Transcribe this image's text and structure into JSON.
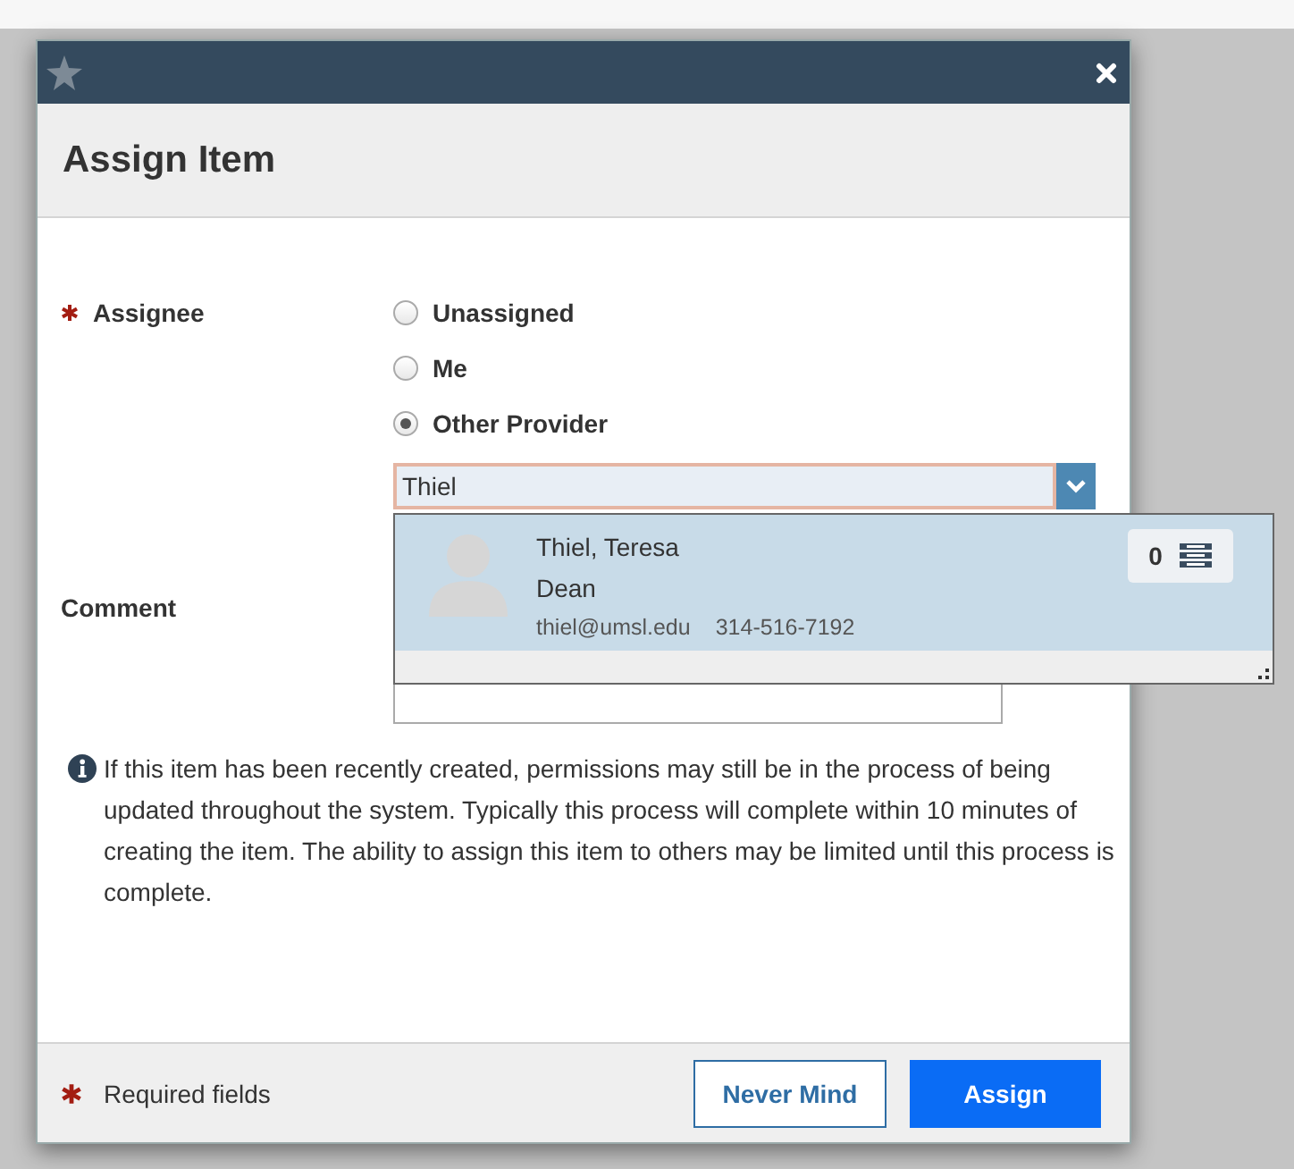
{
  "dialog": {
    "title": "Assign Item",
    "fields": [
      {
        "kind": "radio-group",
        "label": "Assignee",
        "required": true,
        "options": [
          {
            "label": "Unassigned",
            "selected": false
          },
          {
            "label": "Me",
            "selected": false
          },
          {
            "label": "Other Provider",
            "selected": true
          }
        ],
        "search": {
          "value": "Thiel"
        },
        "suggestions": [
          {
            "name": "Thiel, Teresa",
            "title": "Dean",
            "email": "thiel@umsl.edu",
            "phone": "314-516-7192",
            "count": "0",
            "selected": true
          }
        ]
      },
      {
        "kind": "textarea",
        "label": "Comment",
        "required": false
      }
    ],
    "info": "If this item has been recently created, permissions may still be in the process of being updated throughout the system. Typically this process will complete within 10 minutes of creating the item. The ability to assign this item to others may be limited until this process is complete.",
    "footer": {
      "required_note": "Required fields",
      "buttons": [
        {
          "label": "Never Mind",
          "kind": "secondary"
        },
        {
          "label": "Assign",
          "kind": "primary"
        }
      ]
    }
  }
}
